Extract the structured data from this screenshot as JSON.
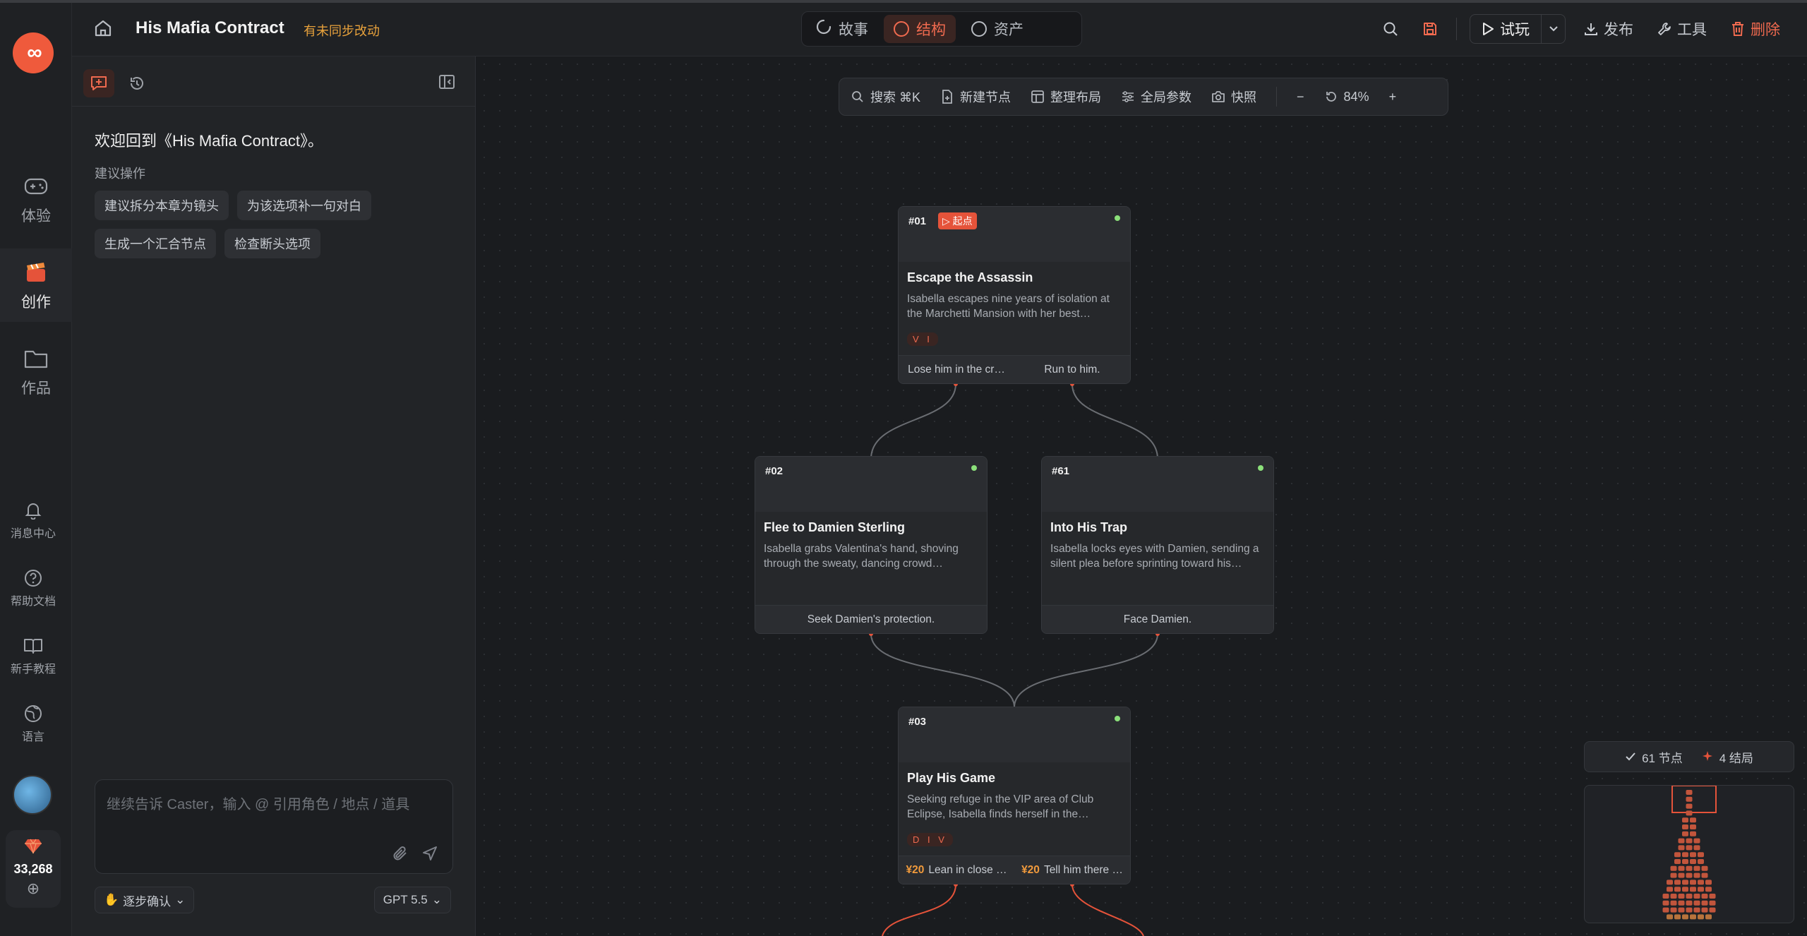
{
  "app": {
    "logo_text": "∞",
    "project_title": "His Mafia Contract",
    "unsaved_notice": "有未同步改动",
    "accent": "#ef5a3c"
  },
  "rail": {
    "items": [
      {
        "label": "体验",
        "icon": "gamepad-icon"
      },
      {
        "label": "创作",
        "icon": "clapperboard-icon"
      },
      {
        "label": "作品",
        "icon": "folder-icon"
      }
    ],
    "bottom": [
      {
        "label": "消息中心",
        "icon": "bell-icon"
      },
      {
        "label": "帮助文档",
        "icon": "help-icon"
      },
      {
        "label": "新手教程",
        "icon": "book-icon"
      },
      {
        "label": "语言",
        "icon": "globe-icon"
      }
    ],
    "credits": "33,268"
  },
  "tabs": [
    {
      "label": "故事"
    },
    {
      "label": "结构"
    },
    {
      "label": "资产"
    }
  ],
  "actions": {
    "play": "试玩",
    "publish": "发布",
    "tools": "工具",
    "delete": "删除"
  },
  "panel": {
    "welcome": "欢迎回到《His Mafia Contract》。",
    "suggest_label": "建议操作",
    "chips": [
      "建议拆分本章为镜头",
      "为该选项补一句对白",
      "生成一个汇合节点",
      "检查断头选项"
    ],
    "input_placeholder": "继续告诉 Caster，输入 @ 引用角色 / 地点 / 道具",
    "step_mode": "逐步确认",
    "model": "GPT 5.5"
  },
  "toolbar": {
    "search": "搜索 ⌘K",
    "new_node": "新建节点",
    "layout": "整理布局",
    "globals": "全局参数",
    "snapshot": "快照",
    "zoom_out": "−",
    "zoom": "84%",
    "zoom_in": "+"
  },
  "nodes": [
    {
      "id": "#01",
      "badge": "▷ 起点",
      "title": "Escape the Assassin",
      "desc": "Isabella escapes nine years of isolation at the Marchetti Mansion with her best…",
      "tags": "V I",
      "choices": [
        {
          "price": "",
          "text": "Lose him in the cr…"
        },
        {
          "price": "",
          "text": "Run to him."
        }
      ]
    },
    {
      "id": "#02",
      "badge": "",
      "title": "Flee to Damien Sterling",
      "desc": "Isabella grabs Valentina's hand, shoving through the sweaty, dancing crowd…",
      "tags": "",
      "choices": [
        {
          "price": "",
          "text": "Seek Damien's protection."
        }
      ]
    },
    {
      "id": "#61",
      "badge": "",
      "title": "Into His Trap",
      "desc": "Isabella locks eyes with Damien, sending a silent plea before sprinting toward his…",
      "tags": "",
      "choices": [
        {
          "price": "",
          "text": "Face Damien."
        }
      ]
    },
    {
      "id": "#03",
      "badge": "",
      "title": "Play His Game",
      "desc": "Seeking refuge in the VIP area of Club Eclipse, Isabella finds herself in the…",
      "tags": "D I V",
      "choices": [
        {
          "price": "¥20",
          "text": "Lean in close …"
        },
        {
          "price": "¥20",
          "text": "Tell him there …"
        }
      ]
    }
  ],
  "stats": {
    "nodes": "61 节点",
    "endings": "4 结局"
  }
}
